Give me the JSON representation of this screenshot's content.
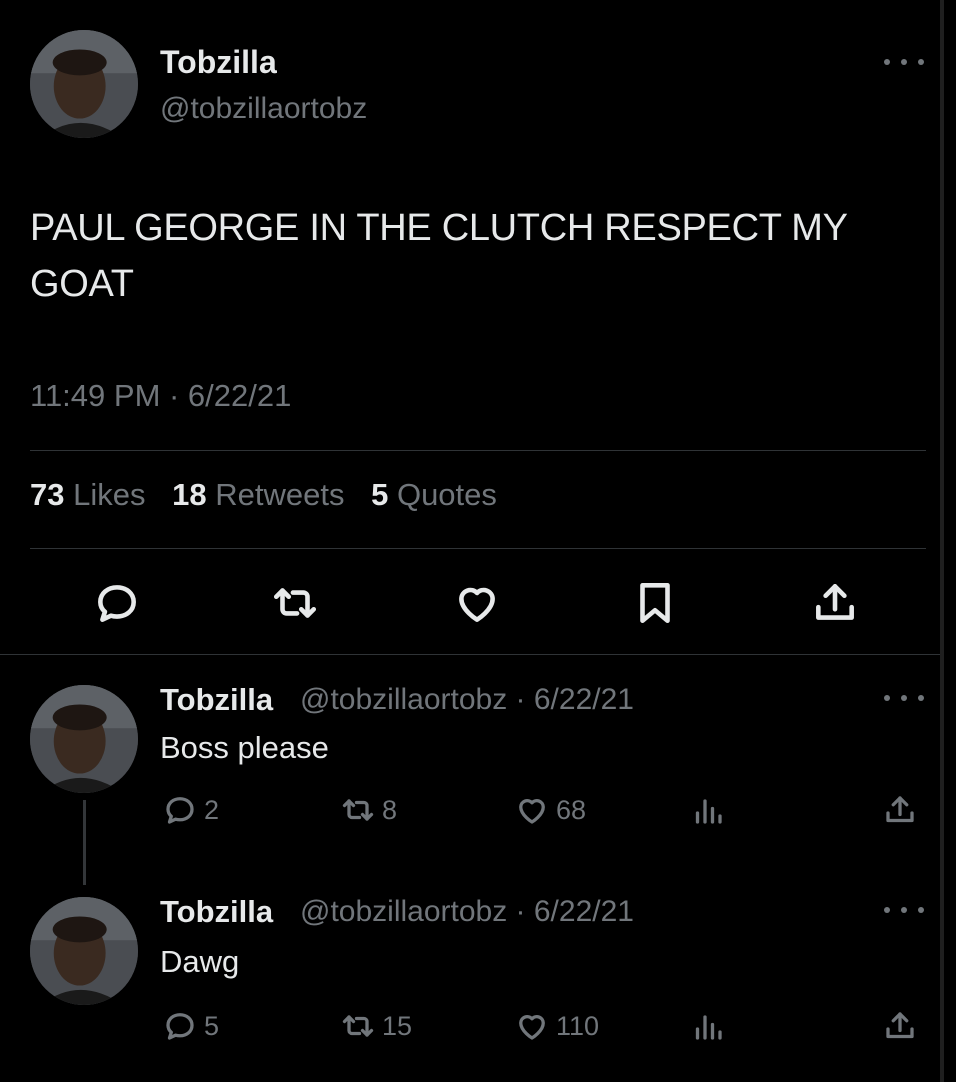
{
  "main_tweet": {
    "display_name": "Tobzilla",
    "handle": "@tobzillaortobz",
    "text": "PAUL GEORGE IN THE CLUTCH RESPECT MY GOAT",
    "timestamp": "11:49 PM · 6/22/21",
    "stats": {
      "likes_count": "73",
      "likes_label": "Likes",
      "retweets_count": "18",
      "retweets_label": "Retweets",
      "quotes_count": "5",
      "quotes_label": "Quotes"
    },
    "actions": [
      "reply-icon",
      "retweet-icon",
      "like-icon",
      "bookmark-icon",
      "share-icon"
    ]
  },
  "replies": [
    {
      "display_name": "Tobzilla",
      "handle_date": "@tobzillaortobz · 6/22/21",
      "text": "Boss please",
      "reply_count": "2",
      "retweet_count": "8",
      "like_count": "68"
    },
    {
      "display_name": "Tobzilla",
      "handle_date": "@tobzillaortobz · 6/22/21",
      "text": "Dawg",
      "reply_count": "5",
      "retweet_count": "15",
      "like_count": "110"
    }
  ],
  "colors": {
    "background": "#000000",
    "text_primary": "#e7e9ea",
    "text_secondary": "#71767b",
    "divider": "#2f3336"
  }
}
